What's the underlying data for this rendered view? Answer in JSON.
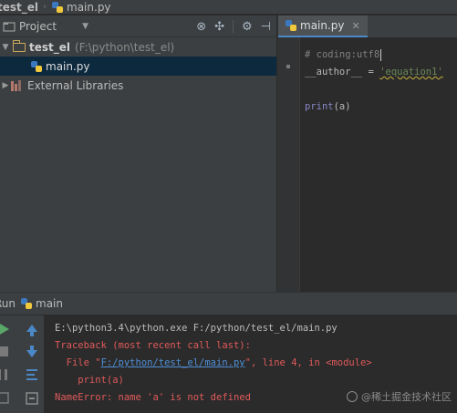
{
  "breadcrumb": {
    "project": "test_el",
    "file": "main.py"
  },
  "project_panel": {
    "title": "Project",
    "tree": {
      "root_name": "test_el",
      "root_path": "(F:\\python\\test_el)",
      "file": "main.py",
      "libraries": "External Libraries"
    }
  },
  "editor": {
    "tab_label": "main.py",
    "lines": {
      "l1": "# coding:utf8",
      "l2_name": "__author__",
      "l2_eq": " = ",
      "l2_str": "'equation1'",
      "l4_fn": "print",
      "l4_args": "(a)"
    }
  },
  "run_panel": {
    "label": "Run",
    "config": "main",
    "output": {
      "cmd": "E:\\python3.4\\python.exe F:/python/test_el/main.py",
      "traceback": "Traceback (most recent call last):",
      "file_pre": "  File \"",
      "file_link": "F:/python/test_el/main.py",
      "file_post": "\", line 4, in <module>",
      "code": "    print(a)",
      "error": "NameError: name 'a' is not defined"
    }
  },
  "watermark": "@稀土掘金技术社区",
  "colors": {
    "accent": "#4a88c7",
    "error": "#e05a5a",
    "link": "#4f8fd7",
    "string": "#6a8759"
  }
}
